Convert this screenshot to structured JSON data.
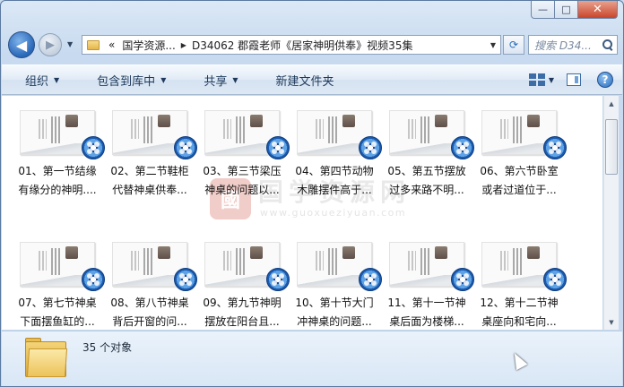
{
  "window": {
    "minimize": "—",
    "maximize": "□",
    "close": "✕"
  },
  "nav": {
    "back": "◀",
    "forward": "▶"
  },
  "address": {
    "overflow": "«",
    "segments": [
      "国学资源...",
      "D34062 郡霞老师《居家神明供奉》视频35集"
    ],
    "separator": "▶"
  },
  "search": {
    "placeholder": "搜索 D34..."
  },
  "commands": [
    {
      "label": "组织",
      "dropdown": true
    },
    {
      "label": "包含到库中",
      "dropdown": true
    },
    {
      "label": "共享",
      "dropdown": true
    },
    {
      "label": "新建文件夹",
      "dropdown": false
    }
  ],
  "files": [
    {
      "line1": "01、第一节结缘",
      "line2": "有缘分的神明...."
    },
    {
      "line1": "02、第二节鞋柜",
      "line2": "代替神桌供奉..."
    },
    {
      "line1": "03、第三节梁压",
      "line2": "神桌的问题以..."
    },
    {
      "line1": "04、第四节动物",
      "line2": "木雕摆件高于..."
    },
    {
      "line1": "05、第五节摆放",
      "line2": "过多来路不明..."
    },
    {
      "line1": "06、第六节卧室",
      "line2": "或者过道位于..."
    },
    {
      "line1": "07、第七节神桌",
      "line2": "下面摆鱼缸的..."
    },
    {
      "line1": "08、第八节神桌",
      "line2": "背后开窗的问..."
    },
    {
      "line1": "09、第九节神明",
      "line2": "摆放在阳台且..."
    },
    {
      "line1": "10、第十节大门",
      "line2": "冲神桌的问题..."
    },
    {
      "line1": "11、第十一节神",
      "line2": "桌后面为楼梯..."
    },
    {
      "line1": "12、第十二节神",
      "line2": "桌座向和宅向..."
    }
  ],
  "watermark": {
    "seal": "國",
    "text": "国学资源网",
    "url": "www.guoxueziyuan.com"
  },
  "status": {
    "count_text": "35 个对象"
  },
  "colors": {
    "accent": "#2a6cbc",
    "folder": "#e4b64a",
    "close": "#c8452a"
  }
}
